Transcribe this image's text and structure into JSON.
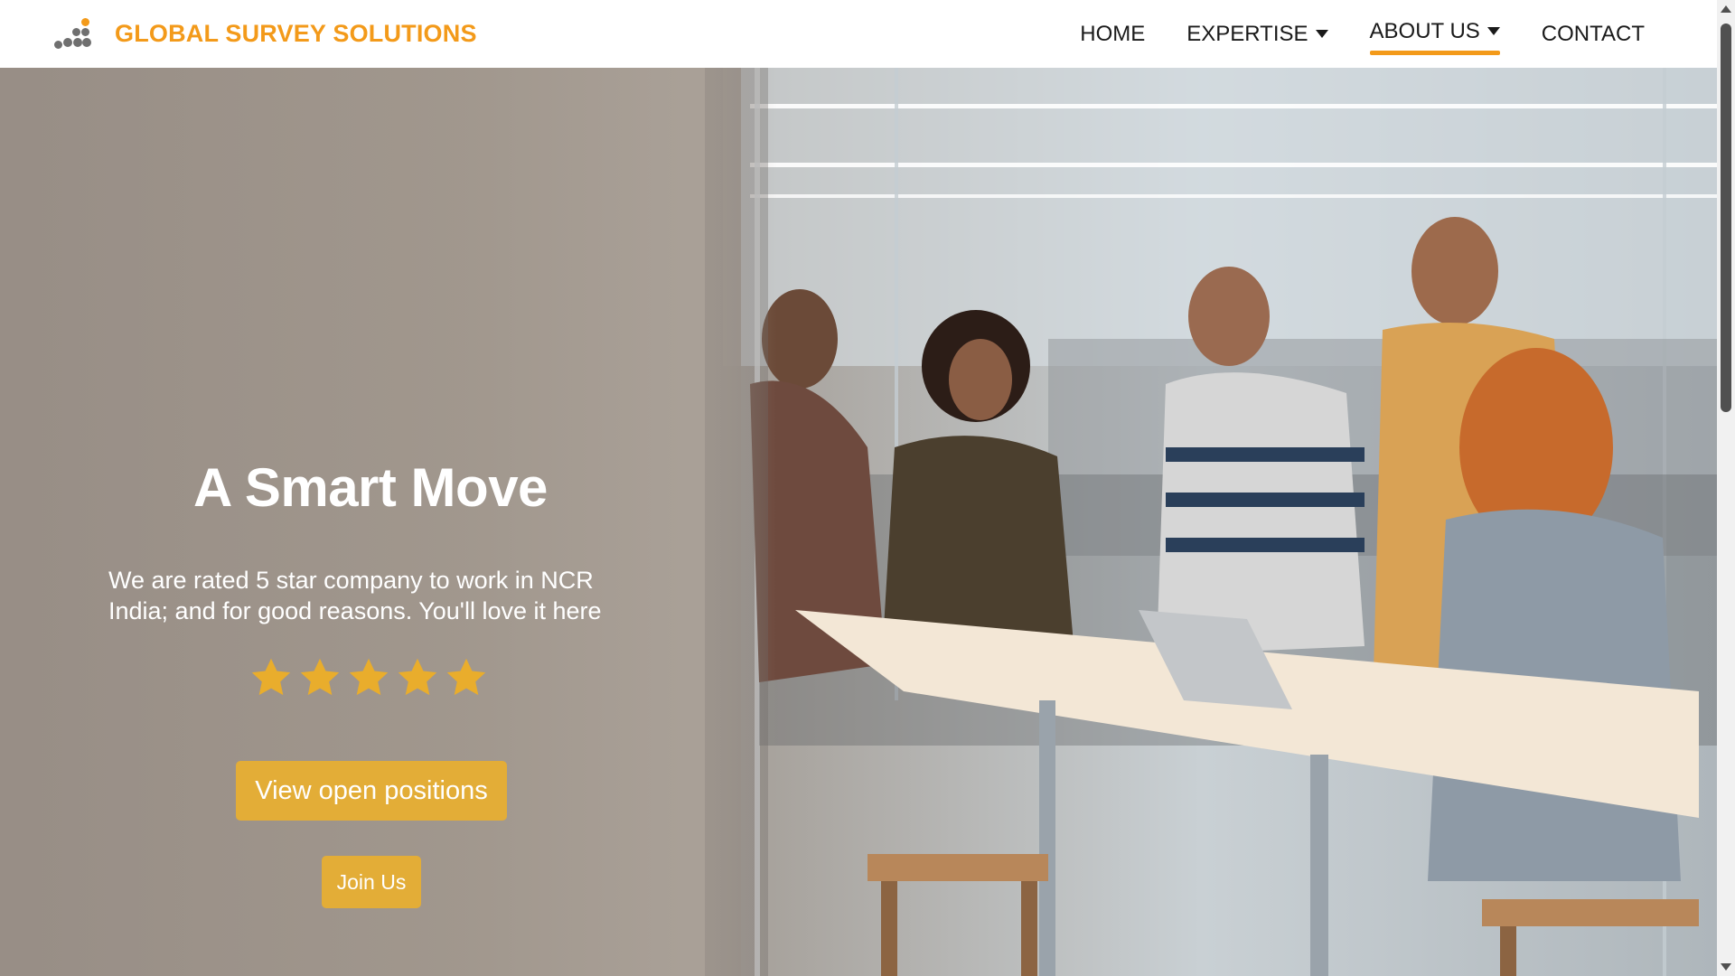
{
  "brand": {
    "name": "GLOBAL SURVEY SOLUTIONS",
    "accent_color": "#f39a1a",
    "logo_icon": "dots-logo-icon"
  },
  "nav": {
    "items": [
      {
        "label": "HOME",
        "has_dropdown": false,
        "active": false
      },
      {
        "label": "EXPERTISE",
        "has_dropdown": true,
        "active": false
      },
      {
        "label": "ABOUT US",
        "has_dropdown": true,
        "active": true
      },
      {
        "label": "CONTACT",
        "has_dropdown": false,
        "active": false
      }
    ]
  },
  "hero": {
    "title": "A Smart Move",
    "subtitle": "We are rated 5 star company to work in NCR India; and for good reasons. You'll love it here",
    "rating": {
      "value": 5,
      "max": 5,
      "star_color": "#e9ad2c"
    },
    "primary_button": "View open positions",
    "secondary_button": "Join Us",
    "button_color": "#e3ad37",
    "image_icon": "office-team-photo"
  }
}
